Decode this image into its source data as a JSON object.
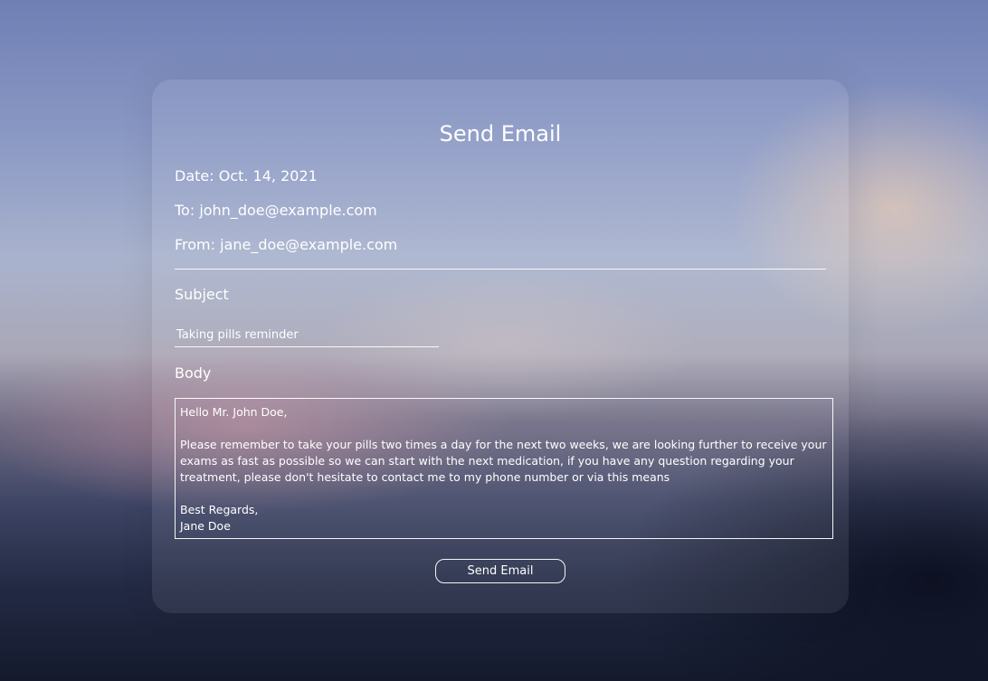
{
  "form": {
    "title": "Send Email",
    "date": "Date: Oct. 14, 2021",
    "to": "To: john_doe@example.com",
    "from": "From: jane_doe@example.com",
    "subject_label": "Subject",
    "subject_value": "Taking pills reminder",
    "body_label": "Body",
    "body_value": "Hello Mr. John Doe,\n\nPlease remember to take your pills two times a day for the next two weeks, we are looking further to receive your exams as fast as possible so we can start with the next medication, if you have any question regarding your treatment, please don't hesitate to contact me to my phone number or via this means\n\nBest Regards,\nJane Doe",
    "send_label": "Send Email"
  }
}
